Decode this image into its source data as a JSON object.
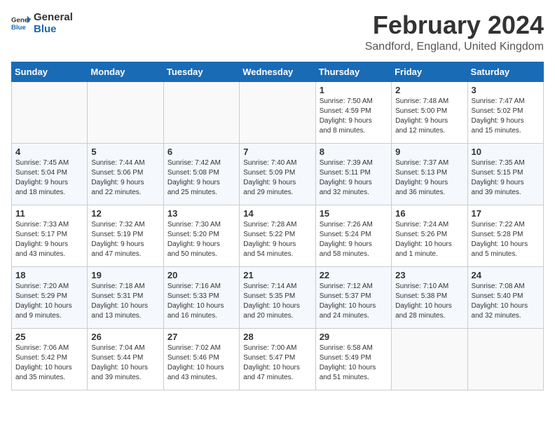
{
  "logo": {
    "text_general": "General",
    "text_blue": "Blue"
  },
  "header": {
    "month": "February 2024",
    "location": "Sandford, England, United Kingdom"
  },
  "days_of_week": [
    "Sunday",
    "Monday",
    "Tuesday",
    "Wednesday",
    "Thursday",
    "Friday",
    "Saturday"
  ],
  "weeks": [
    [
      {
        "day": "",
        "content": ""
      },
      {
        "day": "",
        "content": ""
      },
      {
        "day": "",
        "content": ""
      },
      {
        "day": "",
        "content": ""
      },
      {
        "day": "1",
        "content": "Sunrise: 7:50 AM\nSunset: 4:59 PM\nDaylight: 9 hours\nand 8 minutes."
      },
      {
        "day": "2",
        "content": "Sunrise: 7:48 AM\nSunset: 5:00 PM\nDaylight: 9 hours\nand 12 minutes."
      },
      {
        "day": "3",
        "content": "Sunrise: 7:47 AM\nSunset: 5:02 PM\nDaylight: 9 hours\nand 15 minutes."
      }
    ],
    [
      {
        "day": "4",
        "content": "Sunrise: 7:45 AM\nSunset: 5:04 PM\nDaylight: 9 hours\nand 18 minutes."
      },
      {
        "day": "5",
        "content": "Sunrise: 7:44 AM\nSunset: 5:06 PM\nDaylight: 9 hours\nand 22 minutes."
      },
      {
        "day": "6",
        "content": "Sunrise: 7:42 AM\nSunset: 5:08 PM\nDaylight: 9 hours\nand 25 minutes."
      },
      {
        "day": "7",
        "content": "Sunrise: 7:40 AM\nSunset: 5:09 PM\nDaylight: 9 hours\nand 29 minutes."
      },
      {
        "day": "8",
        "content": "Sunrise: 7:39 AM\nSunset: 5:11 PM\nDaylight: 9 hours\nand 32 minutes."
      },
      {
        "day": "9",
        "content": "Sunrise: 7:37 AM\nSunset: 5:13 PM\nDaylight: 9 hours\nand 36 minutes."
      },
      {
        "day": "10",
        "content": "Sunrise: 7:35 AM\nSunset: 5:15 PM\nDaylight: 9 hours\nand 39 minutes."
      }
    ],
    [
      {
        "day": "11",
        "content": "Sunrise: 7:33 AM\nSunset: 5:17 PM\nDaylight: 9 hours\nand 43 minutes."
      },
      {
        "day": "12",
        "content": "Sunrise: 7:32 AM\nSunset: 5:19 PM\nDaylight: 9 hours\nand 47 minutes."
      },
      {
        "day": "13",
        "content": "Sunrise: 7:30 AM\nSunset: 5:20 PM\nDaylight: 9 hours\nand 50 minutes."
      },
      {
        "day": "14",
        "content": "Sunrise: 7:28 AM\nSunset: 5:22 PM\nDaylight: 9 hours\nand 54 minutes."
      },
      {
        "day": "15",
        "content": "Sunrise: 7:26 AM\nSunset: 5:24 PM\nDaylight: 9 hours\nand 58 minutes."
      },
      {
        "day": "16",
        "content": "Sunrise: 7:24 AM\nSunset: 5:26 PM\nDaylight: 10 hours\nand 1 minute."
      },
      {
        "day": "17",
        "content": "Sunrise: 7:22 AM\nSunset: 5:28 PM\nDaylight: 10 hours\nand 5 minutes."
      }
    ],
    [
      {
        "day": "18",
        "content": "Sunrise: 7:20 AM\nSunset: 5:29 PM\nDaylight: 10 hours\nand 9 minutes."
      },
      {
        "day": "19",
        "content": "Sunrise: 7:18 AM\nSunset: 5:31 PM\nDaylight: 10 hours\nand 13 minutes."
      },
      {
        "day": "20",
        "content": "Sunrise: 7:16 AM\nSunset: 5:33 PM\nDaylight: 10 hours\nand 16 minutes."
      },
      {
        "day": "21",
        "content": "Sunrise: 7:14 AM\nSunset: 5:35 PM\nDaylight: 10 hours\nand 20 minutes."
      },
      {
        "day": "22",
        "content": "Sunrise: 7:12 AM\nSunset: 5:37 PM\nDaylight: 10 hours\nand 24 minutes."
      },
      {
        "day": "23",
        "content": "Sunrise: 7:10 AM\nSunset: 5:38 PM\nDaylight: 10 hours\nand 28 minutes."
      },
      {
        "day": "24",
        "content": "Sunrise: 7:08 AM\nSunset: 5:40 PM\nDaylight: 10 hours\nand 32 minutes."
      }
    ],
    [
      {
        "day": "25",
        "content": "Sunrise: 7:06 AM\nSunset: 5:42 PM\nDaylight: 10 hours\nand 35 minutes."
      },
      {
        "day": "26",
        "content": "Sunrise: 7:04 AM\nSunset: 5:44 PM\nDaylight: 10 hours\nand 39 minutes."
      },
      {
        "day": "27",
        "content": "Sunrise: 7:02 AM\nSunset: 5:46 PM\nDaylight: 10 hours\nand 43 minutes."
      },
      {
        "day": "28",
        "content": "Sunrise: 7:00 AM\nSunset: 5:47 PM\nDaylight: 10 hours\nand 47 minutes."
      },
      {
        "day": "29",
        "content": "Sunrise: 6:58 AM\nSunset: 5:49 PM\nDaylight: 10 hours\nand 51 minutes."
      },
      {
        "day": "",
        "content": ""
      },
      {
        "day": "",
        "content": ""
      }
    ]
  ]
}
